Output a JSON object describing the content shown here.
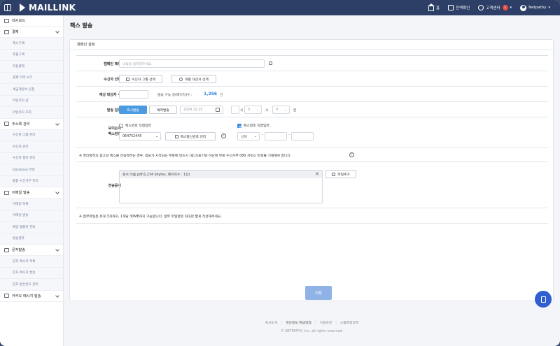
{
  "brand": "MAILLINK",
  "topbar": {
    "home": "홈",
    "balance": "잔액확인",
    "support": "고객센터",
    "support_badge": "1",
    "user": "Netpathy"
  },
  "sidebar": {
    "items": [
      {
        "label": "대시보드",
        "type": "main"
      },
      {
        "label": "결제",
        "type": "main",
        "chev": true
      },
      {
        "label": "캐시구매",
        "type": "sub"
      },
      {
        "label": "후불구매",
        "type": "sub"
      },
      {
        "label": "자동결제",
        "type": "sub"
      },
      {
        "label": "결제 이력 보기",
        "type": "sub"
      },
      {
        "label": "세금계산서 신청",
        "type": "sub"
      },
      {
        "label": "마일리지 샵",
        "type": "sub"
      },
      {
        "label": "마일리지 조회",
        "type": "sub"
      },
      {
        "label": "주소록 관리",
        "type": "main",
        "chev": true
      },
      {
        "label": "수신자 그룹 관리",
        "type": "sub"
      },
      {
        "label": "수신자 관리",
        "type": "sub"
      },
      {
        "label": "수신자 필터 관리",
        "type": "sub"
      },
      {
        "label": "Database 연동",
        "type": "sub"
      },
      {
        "label": "통합 수신거부 관리",
        "type": "sub"
      },
      {
        "label": "이메일 발송",
        "type": "main",
        "chev": true
      },
      {
        "label": "이메일 목록",
        "type": "sub"
      },
      {
        "label": "이메일 발송",
        "type": "sub"
      },
      {
        "label": "메일 템플릿 관리",
        "type": "sub"
      },
      {
        "label": "발송결과",
        "type": "sub"
      },
      {
        "label": "문자발송",
        "type": "main",
        "chev": true
      },
      {
        "label": "문자 메시지 목록",
        "type": "sub"
      },
      {
        "label": "문자 메시지 발송",
        "type": "sub"
      },
      {
        "label": "문자 발신번호 관리",
        "type": "sub"
      },
      {
        "label": "카카오 메시지 발송",
        "type": "main",
        "chev": true
      }
    ]
  },
  "page": {
    "title": "팩스 발송",
    "card_title": "캠페인 설정",
    "campaign_label": "캠페인 제목",
    "campaign_placeholder": "내용을 입력해주세요.",
    "recipient_label": "수신자 선택",
    "recipient_group_btn": "수신자 그룹 선택",
    "recipient_individual_btn": "개별 대상자 선택",
    "expected_label": "예상 대상자 수",
    "sendable_label": "발송 가능 장(페이지)수 :",
    "sendable_value": "1,256",
    "sendable_unit": "건",
    "schedule_label": "발송 일정",
    "schedule_now": "즉시발송",
    "schedule_reserve": "예약발송",
    "date": "2024.12.25",
    "hour_value": "0",
    "hour_unit": "시",
    "minute_value": "0",
    "minute_unit": "분",
    "fax_label_1": "보이는이",
    "fax_label_2": "팩스번호",
    "fax_direct_1": "팩스번호 직접입력",
    "fax_number": "064752445",
    "fax_manage_btn": "팩스발신번호 관리",
    "fax_direct_2": "팩스번호 직접입력",
    "select_label": "선택",
    "notice_1": "※ 영리목적의 광고성 팩스를 전송하려는 경우, 정보가 시작되는 부분에 반드시 (광고)표기와 하단에 무료 수신거부 080 서비스 번호를 기재해야 합니다",
    "doc_label": "전송문서",
    "file_name": "문서 이름.pdf(1,234 kbytes, 페이지수 : 1장)",
    "add_file_btn": "파일추가",
    "notice_2": "※ 첨부파일은 최대 3개까지, 1개당 30MB까지 가능합니다. 첨부 파일명은 최대한 짧게 작성해주세요.",
    "save_btn": "저장"
  },
  "footer": {
    "links": [
      "회사소개",
      "개인정보 취급방침",
      "이용약관",
      "스팸메일정책"
    ],
    "copyright": "© NETPATHY, Inc. all rights reserved."
  }
}
